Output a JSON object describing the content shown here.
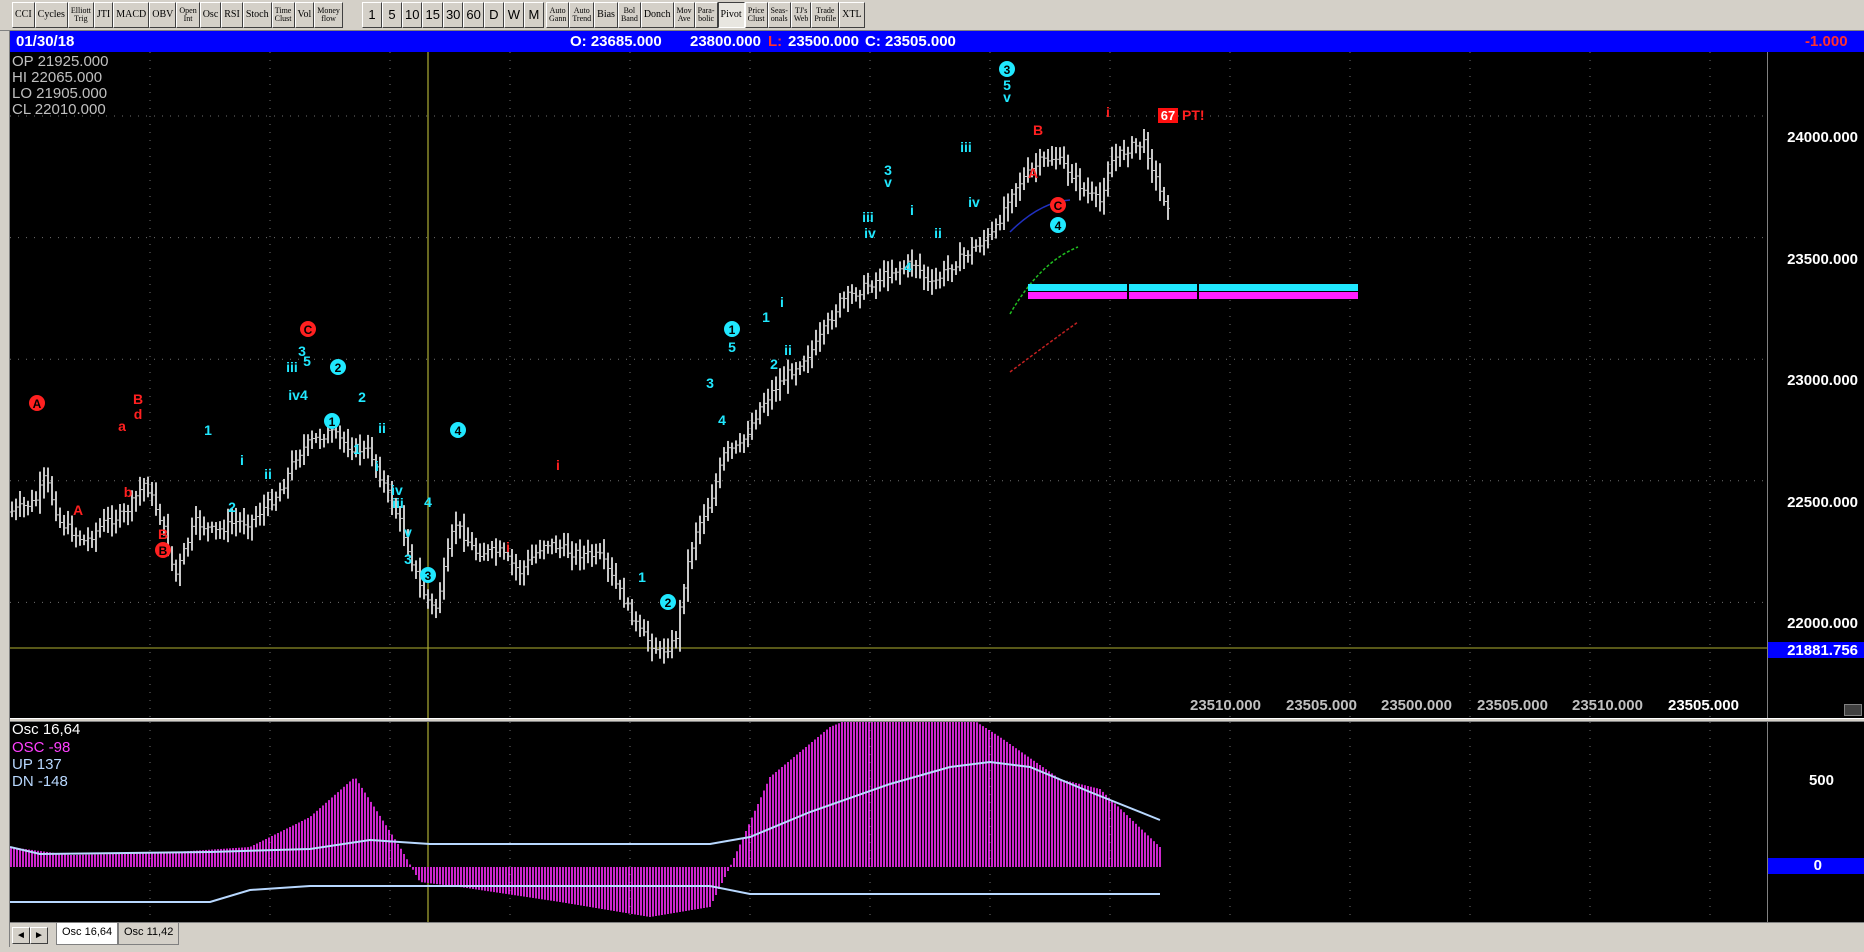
{
  "toolbar": {
    "indicators": [
      "CCI",
      "Cycles",
      "Elliott\nTrig",
      "JTI",
      "MACD",
      "OBV",
      "Open\nInt",
      "Osc",
      "RSI",
      "Stoch",
      "Time\nClust",
      "Vol",
      "Money\nflow"
    ],
    "timeframes": [
      "1",
      "5",
      "10",
      "15",
      "30",
      "60",
      "D",
      "W",
      "M"
    ],
    "tools": [
      "Auto\nGann",
      "Auto\nTrend",
      "Bias",
      "Bol\nBand",
      "Donch",
      "Mov\nAve",
      "Para-\nbolic",
      "Pivot",
      "Price\nClust",
      "Seas-\nonals",
      "TJ's\nWeb",
      "Trade\nProfile",
      "XTL"
    ],
    "pressed_tool": "Pivot"
  },
  "infobar": {
    "date": "01/30/18",
    "open": "O: 23685.000",
    "high": "23800.000",
    "low_label": "L:",
    "low": "23500.000",
    "close": "C: 23505.000",
    "change": "-1.000"
  },
  "ohlc": {
    "op": "OP  21925.000",
    "hi": "HI   22065.000",
    "lo": "LO  21905.000",
    "cl": "CL   22010.000"
  },
  "price_axis": {
    "ticks": [
      "24000.000",
      "23500.000",
      "23000.000",
      "22500.000",
      "22000.000"
    ],
    "current_line": "21881.756"
  },
  "readings": [
    "23510.000",
    "23505.000",
    "23500.000",
    "23505.000",
    "23510.000",
    "23505.000"
  ],
  "pt_label": {
    "num": "67",
    "text": "PT!"
  },
  "osc": {
    "title": "Osc 16,64",
    "osc": "OSC -98",
    "up": "UP    137",
    "dn": "DN    -148",
    "axis_500": "500",
    "axis_0": "0"
  },
  "tabs": [
    "Osc 16,64",
    "Osc 11,42"
  ],
  "nav": {
    "left": "◄",
    "right": "►"
  },
  "wave_labels": {
    "red": [
      {
        "t": "A",
        "c": true
      },
      {
        "t": "B",
        "c": false
      },
      {
        "t": "d",
        "c": false
      },
      {
        "t": "a",
        "c": false
      },
      {
        "t": "b",
        "c": false
      },
      {
        "t": "A",
        "c": false
      },
      {
        "t": "B",
        "c": false
      },
      {
        "t": "B",
        "c": true
      },
      {
        "t": "C",
        "c": true
      },
      {
        "t": "i",
        "c": false
      },
      {
        "t": "i",
        "c": false
      },
      {
        "t": "B",
        "c": false
      },
      {
        "t": "A",
        "c": false
      },
      {
        "t": "C",
        "c": true
      },
      {
        "t": "i",
        "c": false
      }
    ],
    "cyan": [
      {
        "t": "1",
        "c": false
      },
      {
        "t": "2",
        "c": false
      },
      {
        "t": "i",
        "c": false
      },
      {
        "t": "ii",
        "c": false
      },
      {
        "t": "3",
        "c": false
      },
      {
        "t": "5",
        "c": false
      },
      {
        "t": "iii",
        "c": false
      },
      {
        "t": "iv4",
        "c": false
      },
      {
        "t": "2",
        "c": true
      },
      {
        "t": "1",
        "c": true
      },
      {
        "t": "2",
        "c": false
      },
      {
        "t": "1",
        "c": false
      },
      {
        "t": "ii",
        "c": false
      },
      {
        "t": "i",
        "c": false
      },
      {
        "t": "iv",
        "c": false
      },
      {
        "t": "iii",
        "c": false
      },
      {
        "t": "v",
        "c": false
      },
      {
        "t": "3",
        "c": false
      },
      {
        "t": "3",
        "c": true
      },
      {
        "t": "4",
        "c": false
      },
      {
        "t": "4",
        "c": true
      },
      {
        "t": "1",
        "c": false
      },
      {
        "t": "2",
        "c": true
      },
      {
        "t": "3",
        "c": false
      },
      {
        "t": "4",
        "c": false
      },
      {
        "t": "1",
        "c": true
      },
      {
        "t": "5",
        "c": false
      },
      {
        "t": "1",
        "c": false
      },
      {
        "t": "2",
        "c": false
      },
      {
        "t": "i",
        "c": false
      },
      {
        "t": "ii",
        "c": false
      },
      {
        "t": "3",
        "c": false
      },
      {
        "t": "v",
        "c": false
      },
      {
        "t": "iii",
        "c": false
      },
      {
        "t": "iv",
        "c": false
      },
      {
        "t": "i",
        "c": false
      },
      {
        "t": "ii",
        "c": false
      },
      {
        "t": "4",
        "c": false
      },
      {
        "t": "iii",
        "c": false
      },
      {
        "t": "iv",
        "c": false
      },
      {
        "t": "3",
        "c": true
      },
      {
        "t": "5",
        "c": false
      },
      {
        "t": "v",
        "c": false
      },
      {
        "t": "4",
        "c": true
      }
    ]
  },
  "colors": {
    "bar": "#c8c8c8",
    "wave_red": "#ff2020",
    "wave_cyan": "#20e8ff",
    "osc_hist": "#ff30ff",
    "osc_line": "#b8d8ff",
    "zone_cyan": "#20e8ff",
    "zone_magenta": "#ff20ff",
    "infobar": "#0000ff"
  }
}
